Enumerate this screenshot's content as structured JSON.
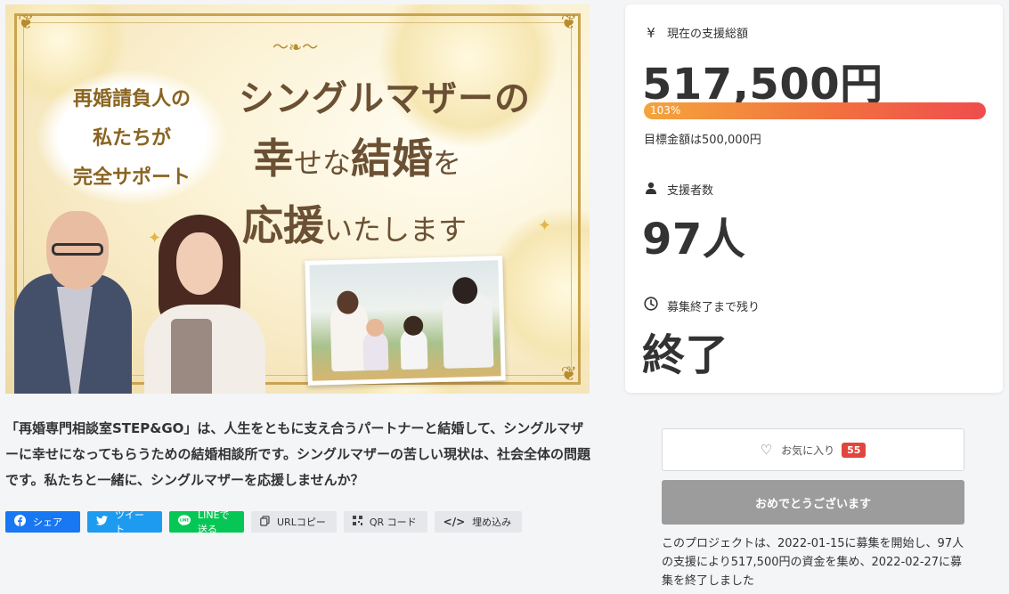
{
  "hero": {
    "sub_lines": [
      "再婚請負人の",
      "私たちが",
      "完全サポート"
    ],
    "title_line1": "シングルマザーの",
    "title_line2_a": "幸",
    "title_line2_b": "せな",
    "title_line2_c": "結婚",
    "title_line2_d": "を",
    "title_line3_a": "応援",
    "title_line3_b": "いたします"
  },
  "stats": {
    "total_label": "現在の支援総額",
    "total_value": "517,500円",
    "progress_label": "103%",
    "progress_fraction": 1.03,
    "goal_text": "目標金額は500,000円",
    "backers_label": "支援者数",
    "backers_value": "97人",
    "remaining_label": "募集終了まで残り",
    "remaining_value": "終了",
    "yen_icon": "yen-icon",
    "person_icon": "person-icon",
    "clock_icon": "clock-icon"
  },
  "description": "「再婚専門相談室STEP&GO」は、人生をともに支え合うパートナーと結婚して、シングルマザーに幸せになってもらうための結婚相談所です。シングルマザーの苦しい現状は、社会全体の問題です。私たちと一緒に、シングルマザーを応援しませんか？",
  "share": {
    "facebook": "シェア",
    "twitter": "ツイート",
    "line": "LINEで送る",
    "url_copy": "URLコピー",
    "qr": "QR コード",
    "embed": "埋め込み"
  },
  "actions": {
    "favorite_label": "お気に入り",
    "favorite_count": "55",
    "status_button": "おめでとうございます",
    "summary": "このプロジェクトは、2022-01-15に募集を開始し、97人の支援により517,500円の資金を集め、2022-02-27に募集を終了しました"
  },
  "colors": {
    "facebook": "#1877f2",
    "twitter": "#1d9bf0",
    "line": "#06c755",
    "badge": "#e0463f",
    "progress_start": "#f4a43c",
    "progress_end": "#ef4d4d"
  }
}
